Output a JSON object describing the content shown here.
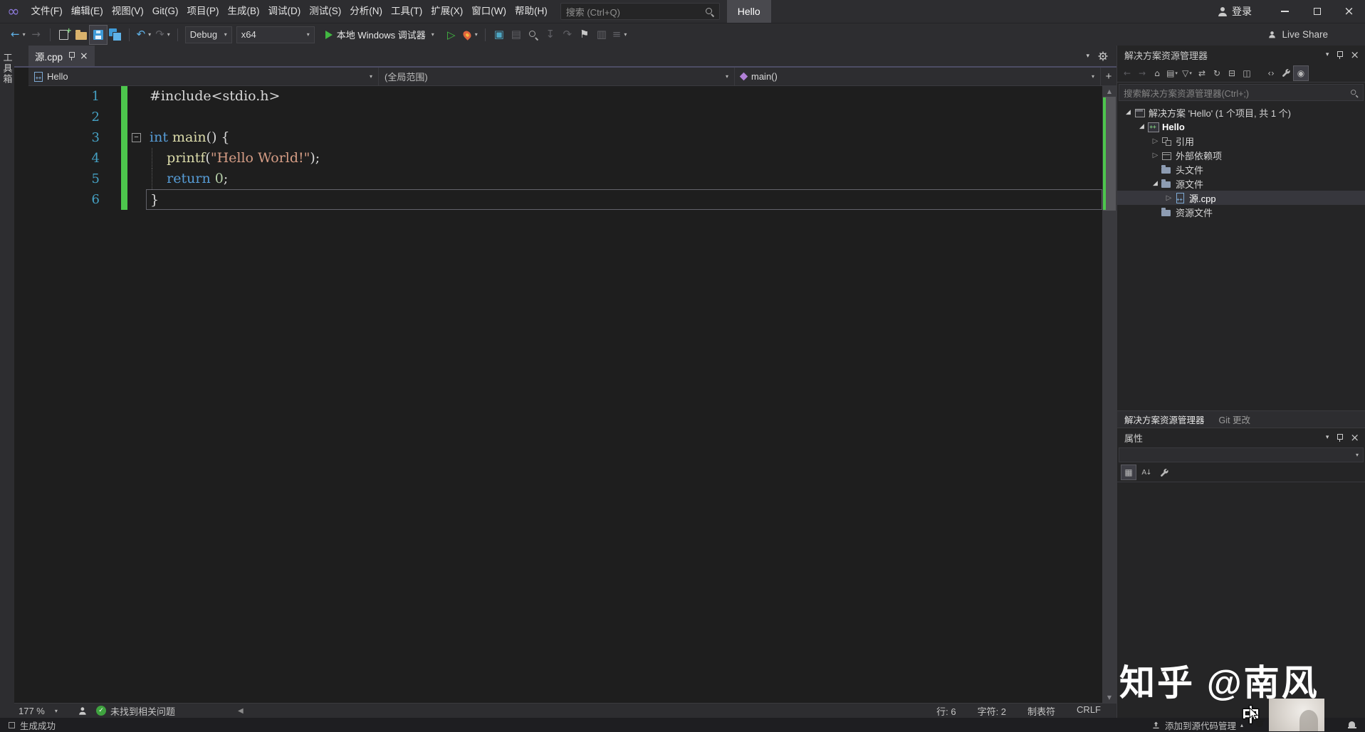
{
  "colors": {
    "editor_background": "#1e1e1e",
    "chrome_background": "#2d2d30",
    "panel_background": "#252526",
    "keyword_blue": "#569cd6",
    "function_yellow": "#dcdcaa",
    "string_orange": "#d69d85",
    "number_green": "#b5cea8",
    "line_number_teal": "#45a1c4",
    "change_bar_green": "#4dc64d",
    "run_green": "#42b842",
    "hot_reload_orange": "#e0643e",
    "save_blue": "#3f9bd8",
    "tree_selection_gray": "#37373d"
  },
  "titlebar": {
    "menus": [
      "文件(F)",
      "编辑(E)",
      "视图(V)",
      "Git(G)",
      "项目(P)",
      "生成(B)",
      "调试(D)",
      "测试(S)",
      "分析(N)",
      "工具(T)",
      "扩展(X)",
      "窗口(W)",
      "帮助(H)"
    ],
    "search_placeholder": "搜索 (Ctrl+Q)",
    "solution_badge": "Hello",
    "sign_in": "登录"
  },
  "toolbar": {
    "configuration": "Debug",
    "platform": "x64",
    "start_debug_label": "本地 Windows 调试器",
    "live_share_label": "Live Share"
  },
  "left_edge": {
    "toolbox_tab": "工具箱"
  },
  "editor": {
    "tab_title": "源.cpp",
    "nav_project": "Hello",
    "nav_scope": "(全局范围)",
    "nav_member": "main()",
    "code_lines": [
      {
        "num": "1",
        "segs": [
          {
            "c": "pp",
            "t": "#include<stdio.h>"
          }
        ]
      },
      {
        "num": "2",
        "segs": []
      },
      {
        "num": "3",
        "fold": true,
        "segs": [
          {
            "c": "kw",
            "t": "int"
          },
          {
            "c": "pl",
            "t": " "
          },
          {
            "c": "fn",
            "t": "main"
          },
          {
            "c": "pl",
            "t": "() {"
          }
        ]
      },
      {
        "num": "4",
        "guide": true,
        "segs": [
          {
            "c": "pl",
            "t": "    "
          },
          {
            "c": "fn",
            "t": "printf"
          },
          {
            "c": "pl",
            "t": "("
          },
          {
            "c": "str",
            "t": "\"Hello World!\""
          },
          {
            "c": "pl",
            "t": ");"
          }
        ]
      },
      {
        "num": "5",
        "guide": true,
        "segs": [
          {
            "c": "pl",
            "t": "    "
          },
          {
            "c": "kw",
            "t": "return"
          },
          {
            "c": "pl",
            "t": " "
          },
          {
            "c": "num",
            "t": "0"
          },
          {
            "c": "pl",
            "t": ";"
          }
        ]
      },
      {
        "num": "6",
        "current": true,
        "segs": [
          {
            "c": "pl",
            "t": "}"
          }
        ]
      }
    ]
  },
  "editor_status": {
    "zoom": "177 %",
    "analysis": "未找到相关问题",
    "line": "行: 6",
    "column": "字符: 2",
    "indent": "制表符",
    "line_ending": "CRLF"
  },
  "solution_explorer": {
    "title": "解决方案资源管理器",
    "search_placeholder": "搜索解决方案资源管理器(Ctrl+;)",
    "tree": [
      {
        "label": "解决方案 'Hello' (1 个项目, 共 1 个)",
        "indent": 0,
        "arrow": "open",
        "icon": "solution"
      },
      {
        "label": "Hello",
        "indent": 1,
        "arrow": "open",
        "icon": "project",
        "bold": true
      },
      {
        "label": "引用",
        "indent": 2,
        "arrow": "closed",
        "icon": "references"
      },
      {
        "label": "外部依赖项",
        "indent": 2,
        "arrow": "closed",
        "icon": "dependencies"
      },
      {
        "label": "头文件",
        "indent": 2,
        "arrow": "none",
        "icon": "folder"
      },
      {
        "label": "源文件",
        "indent": 2,
        "arrow": "open",
        "icon": "folder"
      },
      {
        "label": "源.cpp",
        "indent": 3,
        "arrow": "closed",
        "icon": "cpp",
        "selected": true
      },
      {
        "label": "资源文件",
        "indent": 2,
        "arrow": "none",
        "icon": "folder"
      }
    ],
    "bottom_tabs": [
      "解决方案资源管理器",
      "Git 更改"
    ]
  },
  "properties_panel": {
    "title": "属性"
  },
  "status_bar": {
    "build_status": "生成成功",
    "source_control": "添加到源代码管理"
  },
  "watermark": "知乎 @南风",
  "ime_indicator": "中"
}
